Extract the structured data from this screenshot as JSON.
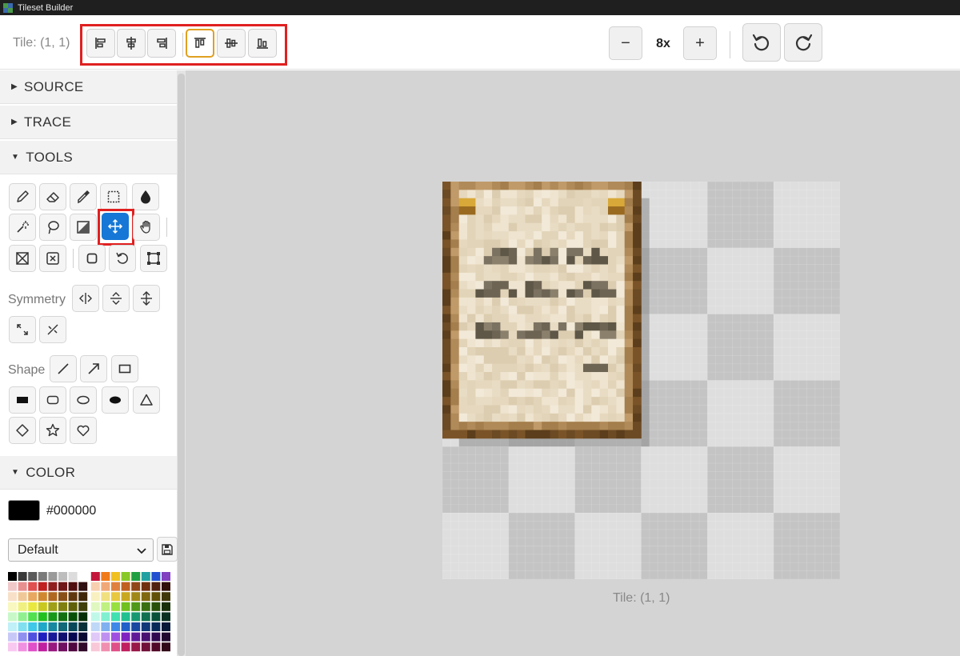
{
  "window": {
    "title": "Tileset Builder"
  },
  "toolbar": {
    "tile_label": "Tile: (1, 1)",
    "align_buttons": [
      "align-left",
      "align-center-horizontal",
      "align-right",
      "align-top",
      "align-middle",
      "align-bottom"
    ],
    "active_align": "align-top",
    "zoom_out_label": "−",
    "zoom_level": "8x",
    "zoom_in_label": "+"
  },
  "sidebar": {
    "sections": {
      "source": "SOURCE",
      "trace": "TRACE",
      "tools": "TOOLS",
      "color": "COLOR"
    },
    "tools": [
      "pencil",
      "eraser",
      "eyedropper",
      "rect-select",
      "fill",
      "magic-wand",
      "lasso",
      "gradient",
      "move",
      "pan",
      "clear",
      "delete",
      "outline",
      "rotate",
      "transform"
    ],
    "selected_tool": "move",
    "symmetry_label": "Symmetry",
    "shape_label": "Shape",
    "color": {
      "hex": "#000000",
      "palette_name": "Default"
    }
  },
  "canvas": {
    "caption": "Tile: (1, 1)"
  },
  "colors": {
    "accent_blue": "#1677d6",
    "highlight_red": "#e02020",
    "active_orange": "#e0a020"
  }
}
